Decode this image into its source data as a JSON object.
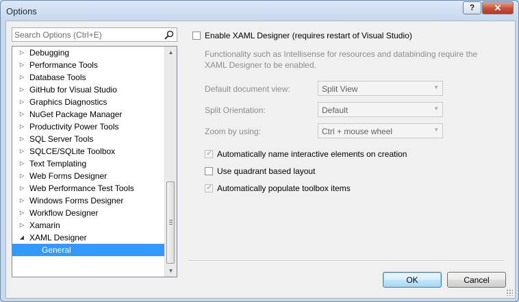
{
  "window": {
    "title": "Options",
    "help_glyph": "?",
    "close_glyph": "✕"
  },
  "search": {
    "placeholder": "Search Options (Ctrl+E)"
  },
  "tree": {
    "items": [
      {
        "label": "Debugging",
        "expanded": false
      },
      {
        "label": "Performance Tools",
        "expanded": false
      },
      {
        "label": "Database Tools",
        "expanded": false
      },
      {
        "label": "GitHub for Visual Studio",
        "expanded": false
      },
      {
        "label": "Graphics Diagnostics",
        "expanded": false
      },
      {
        "label": "NuGet Package Manager",
        "expanded": false
      },
      {
        "label": "Productivity Power Tools",
        "expanded": false
      },
      {
        "label": "SQL Server Tools",
        "expanded": false
      },
      {
        "label": "SQLCE/SQLite Toolbox",
        "expanded": false
      },
      {
        "label": "Text Templating",
        "expanded": false
      },
      {
        "label": "Web Forms Designer",
        "expanded": false
      },
      {
        "label": "Web Performance Test Tools",
        "expanded": false
      },
      {
        "label": "Windows Forms Designer",
        "expanded": false
      },
      {
        "label": "Workflow Designer",
        "expanded": false
      },
      {
        "label": "Xamarin",
        "expanded": false
      },
      {
        "label": "XAML Designer",
        "expanded": true
      },
      {
        "label": "General",
        "child": true,
        "selected": true
      }
    ],
    "collapsed_arrow": "▷",
    "expanded_arrow": "◢"
  },
  "settings": {
    "enable_label": "Enable XAML Designer (requires restart of Visual Studio)",
    "enable_checked": false,
    "description": "Functionality such as Intellisense for resources and databinding require the XAML Designer to be enabled.",
    "default_view_label": "Default document view:",
    "default_view_value": "Split View",
    "split_orientation_label": "Split Orientation:",
    "split_orientation_value": "Default",
    "zoom_label": "Zoom by using:",
    "zoom_value": "Ctrl + mouse wheel",
    "auto_name_label": "Automatically name interactive elements on creation",
    "auto_name_checked": true,
    "quadrant_label": "Use quadrant based layout",
    "quadrant_checked": false,
    "populate_label": "Automatically populate toolbox items",
    "populate_checked": true
  },
  "buttons": {
    "ok": "OK",
    "cancel": "Cancel"
  }
}
